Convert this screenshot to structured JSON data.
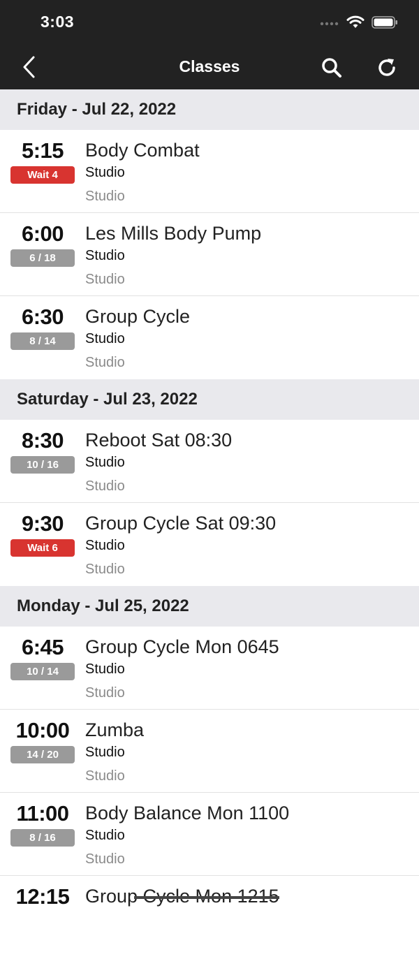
{
  "status_bar": {
    "time": "3:03"
  },
  "nav": {
    "title": "Classes"
  },
  "sections": [
    {
      "header": "Friday - Jul 22, 2022",
      "classes": [
        {
          "time": "5:15",
          "badge": "Wait 4",
          "badge_type": "wait",
          "name": "Body Combat",
          "studio": "Studio",
          "location": "Studio"
        },
        {
          "time": "6:00",
          "badge": "6 / 18",
          "badge_type": "count",
          "name": "Les Mills Body Pump",
          "studio": "Studio",
          "location": "Studio"
        },
        {
          "time": "6:30",
          "badge": "8 / 14",
          "badge_type": "count",
          "name": "Group Cycle",
          "studio": "Studio",
          "location": "Studio"
        }
      ]
    },
    {
      "header": "Saturday - Jul 23, 2022",
      "classes": [
        {
          "time": "8:30",
          "badge": "10 / 16",
          "badge_type": "count",
          "name": "Reboot Sat 08:30",
          "studio": "Studio",
          "location": "Studio"
        },
        {
          "time": "9:30",
          "badge": "Wait 6",
          "badge_type": "wait",
          "name": "Group Cycle Sat 09:30",
          "studio": "Studio",
          "location": "Studio"
        }
      ]
    },
    {
      "header": "Monday - Jul 25, 2022",
      "classes": [
        {
          "time": "6:45",
          "badge": "10 / 14",
          "badge_type": "count",
          "name": "Group Cycle Mon 0645",
          "studio": "Studio",
          "location": "Studio"
        },
        {
          "time": "10:00",
          "badge": "14 / 20",
          "badge_type": "count",
          "name": "Zumba",
          "studio": "Studio",
          "location": "Studio"
        },
        {
          "time": "11:00",
          "badge": "8 / 16",
          "badge_type": "count",
          "name": "Body Balance Mon 1100",
          "studio": "Studio",
          "location": "Studio"
        },
        {
          "time": "12:15",
          "badge": "",
          "badge_type": "none",
          "name": "Group Cycle Mon 1215",
          "studio": "",
          "location": "",
          "cancelled": true
        }
      ]
    }
  ],
  "colors": {
    "bar": "#222222",
    "section": "#e9e9ed",
    "wait": "#d83430",
    "count": "#9a9a9a"
  }
}
